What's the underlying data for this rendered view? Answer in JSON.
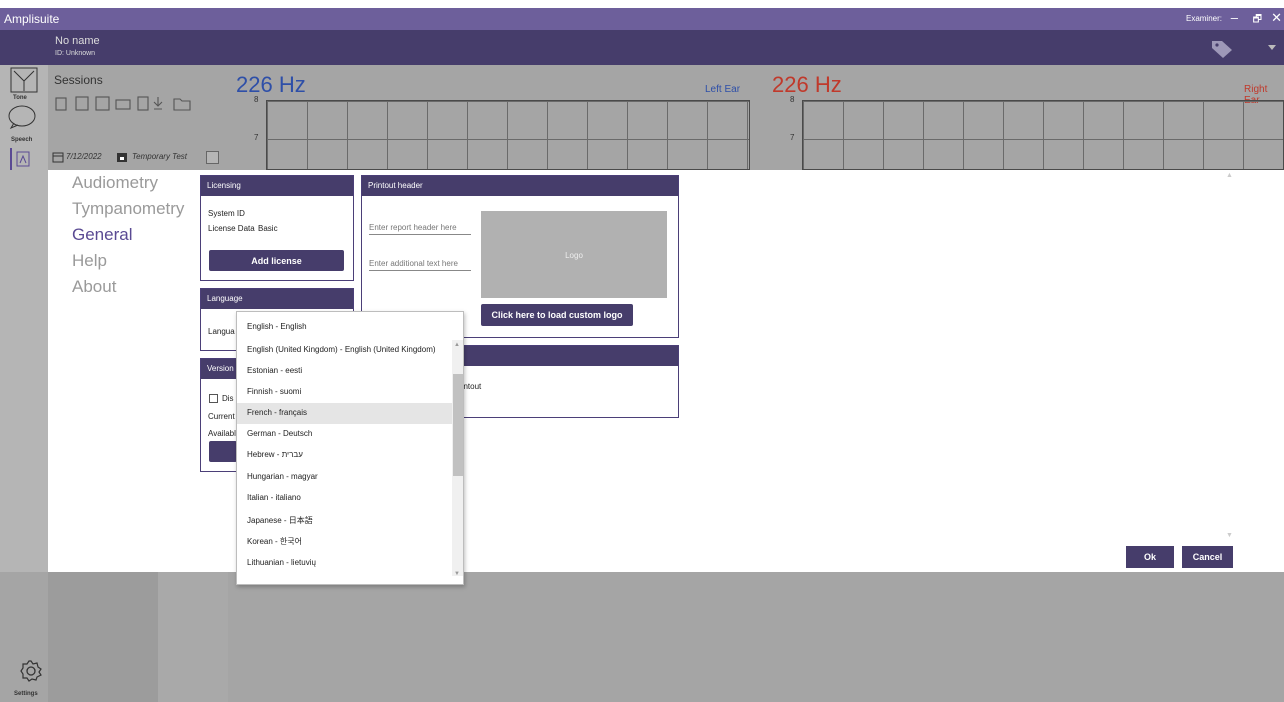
{
  "window": {
    "title": "Amplisuite",
    "examiner_label": "Examiner:",
    "controls": [
      "–",
      "🗗",
      "✕"
    ]
  },
  "patient": {
    "name": "No name",
    "id": "ID: Unknown"
  },
  "left_nav": {
    "tone_label": "Tone",
    "speech_label": "Speech",
    "settings_label": "Settings"
  },
  "sessions": {
    "title": "Sessions",
    "date": "7/12/2022",
    "session_name": "Temporary Test"
  },
  "graphs": {
    "left": {
      "title": "226 Hz",
      "ear": "Left Ear",
      "tick_8": "8",
      "tick_7": "7"
    },
    "right": {
      "title": "226 Hz",
      "ear": "Right Ear",
      "tick_8": "8",
      "tick_7": "7"
    }
  },
  "settings_nav": [
    "Audiometry",
    "Tympanometry",
    "General",
    "Help",
    "About"
  ],
  "licensing": {
    "header": "Licensing",
    "system_id_label": "System ID",
    "license_data_label": "License Data",
    "license_data_value": "Basic",
    "add_license_button": "Add license"
  },
  "printout": {
    "header": "Printout header",
    "header_placeholder": "Enter report header here",
    "additional_placeholder": "Enter additional text here",
    "logo_label": "Logo",
    "load_logo_button": "Click here to load custom logo",
    "partial_text": "rintout"
  },
  "language": {
    "header": "Language",
    "label_partial": "Langua",
    "options": [
      "English - English",
      "English (United Kingdom) - English (United Kingdom)",
      "Estonian - eesti",
      "Finnish - suomi",
      "French - français",
      "German - Deutsch",
      "Hebrew - עברית",
      "Hungarian - magyar",
      "Italian - italiano",
      "Japanese - 日本語",
      "Korean - 한국어",
      "Lithuanian - lietuvių"
    ],
    "highlighted_option": "French - français"
  },
  "version": {
    "header": "Version",
    "checkbox_partial": "Dis",
    "current_partial": "Current",
    "available_partial": "Availabl"
  },
  "dialog": {
    "ok": "Ok",
    "cancel": "Cancel"
  },
  "colors": {
    "accent": "#463d6b",
    "left_ear": "#2e4fa8",
    "right_ear": "#c0392b",
    "nav_active": "#5a4a93"
  }
}
